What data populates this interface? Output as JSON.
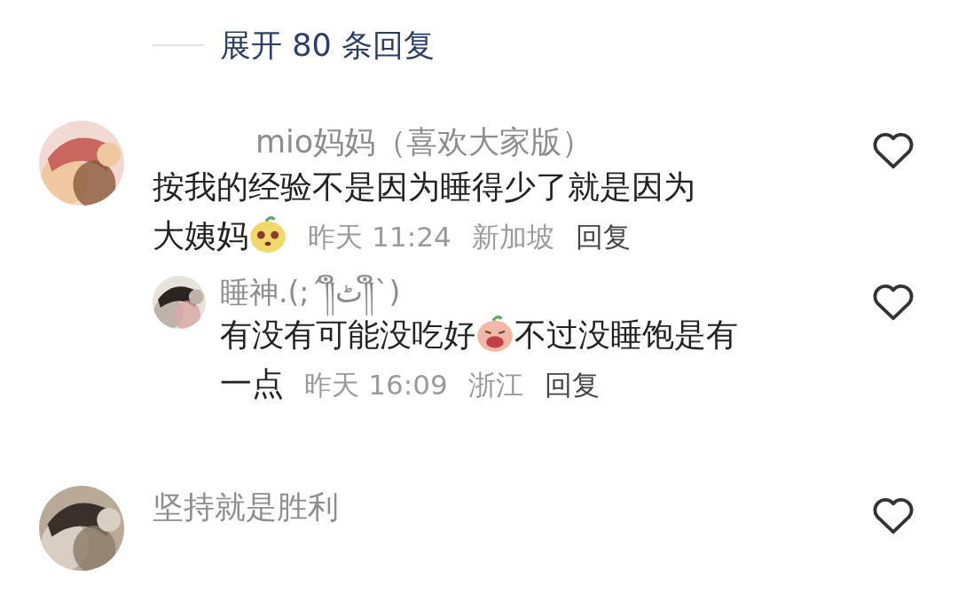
{
  "expand_replies": {
    "label": "展开 80 条回复"
  },
  "comments": [
    {
      "author": "mio妈妈（喜欢大家版）",
      "lines": [
        [
          {
            "kind": "text",
            "text": "按我的经验不是因为睡得少了就是因为"
          }
        ],
        [
          {
            "kind": "text",
            "text": "大姨妈"
          },
          {
            "kind": "sticker"
          }
        ]
      ],
      "time": "昨天 11:24",
      "location": "新加坡",
      "reply_label": "回复",
      "liked": false,
      "replies": [
        {
          "author": "睡神.(;´༎ຶٹ༎ຶ`)",
          "lines": [
            [
              {
                "kind": "text",
                "text": "有没有可能没吃好"
              },
              {
                "kind": "sticker"
              },
              {
                "kind": "text",
                "text": "不过没睡饱是有"
              }
            ],
            [
              {
                "kind": "text",
                "text": "一点"
              }
            ]
          ],
          "time": "昨天 16:09",
          "location": "浙江",
          "reply_label": "回复",
          "liked": false
        }
      ]
    },
    {
      "author": "坚持就是胜利",
      "liked": false
    }
  ]
}
